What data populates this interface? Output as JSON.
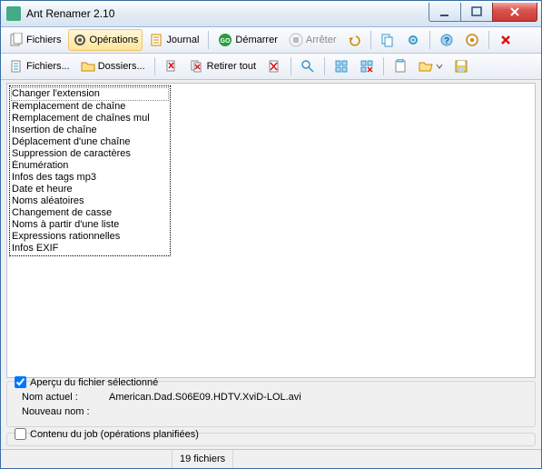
{
  "title": "Ant Renamer 2.10",
  "main_tabs": {
    "files": "Fichiers",
    "operations": "Opérations",
    "journal": "Journal"
  },
  "toolbar1": {
    "start": "Démarrer",
    "stop": "Arrêter"
  },
  "toolbar2": {
    "files": "Fichiers...",
    "folders": "Dossiers...",
    "remove_all": "Retirer tout"
  },
  "operations": [
    "Changer l'extension",
    "Remplacement de chaîne",
    "Remplacement de chaînes mul",
    "Insertion de chaîne",
    "Déplacement d'une chaîne",
    "Suppression de caractères",
    "Énumération",
    "Infos des tags mp3",
    "Date et heure",
    "Noms aléatoires",
    "Changement de casse",
    "Noms à partir d'une liste",
    "Expressions rationnelles",
    "Infos EXIF"
  ],
  "preview": {
    "group_label": "Aperçu du fichier sélectionné",
    "current_label": "Nom actuel :",
    "current_value": "American.Dad.S06E09.HDTV.XviD-LOL.avi",
    "new_label": "Nouveau nom :",
    "new_value": ""
  },
  "job": {
    "group_label": "Contenu du job (opérations planifiées)"
  },
  "status": {
    "count": "19 fichiers"
  }
}
